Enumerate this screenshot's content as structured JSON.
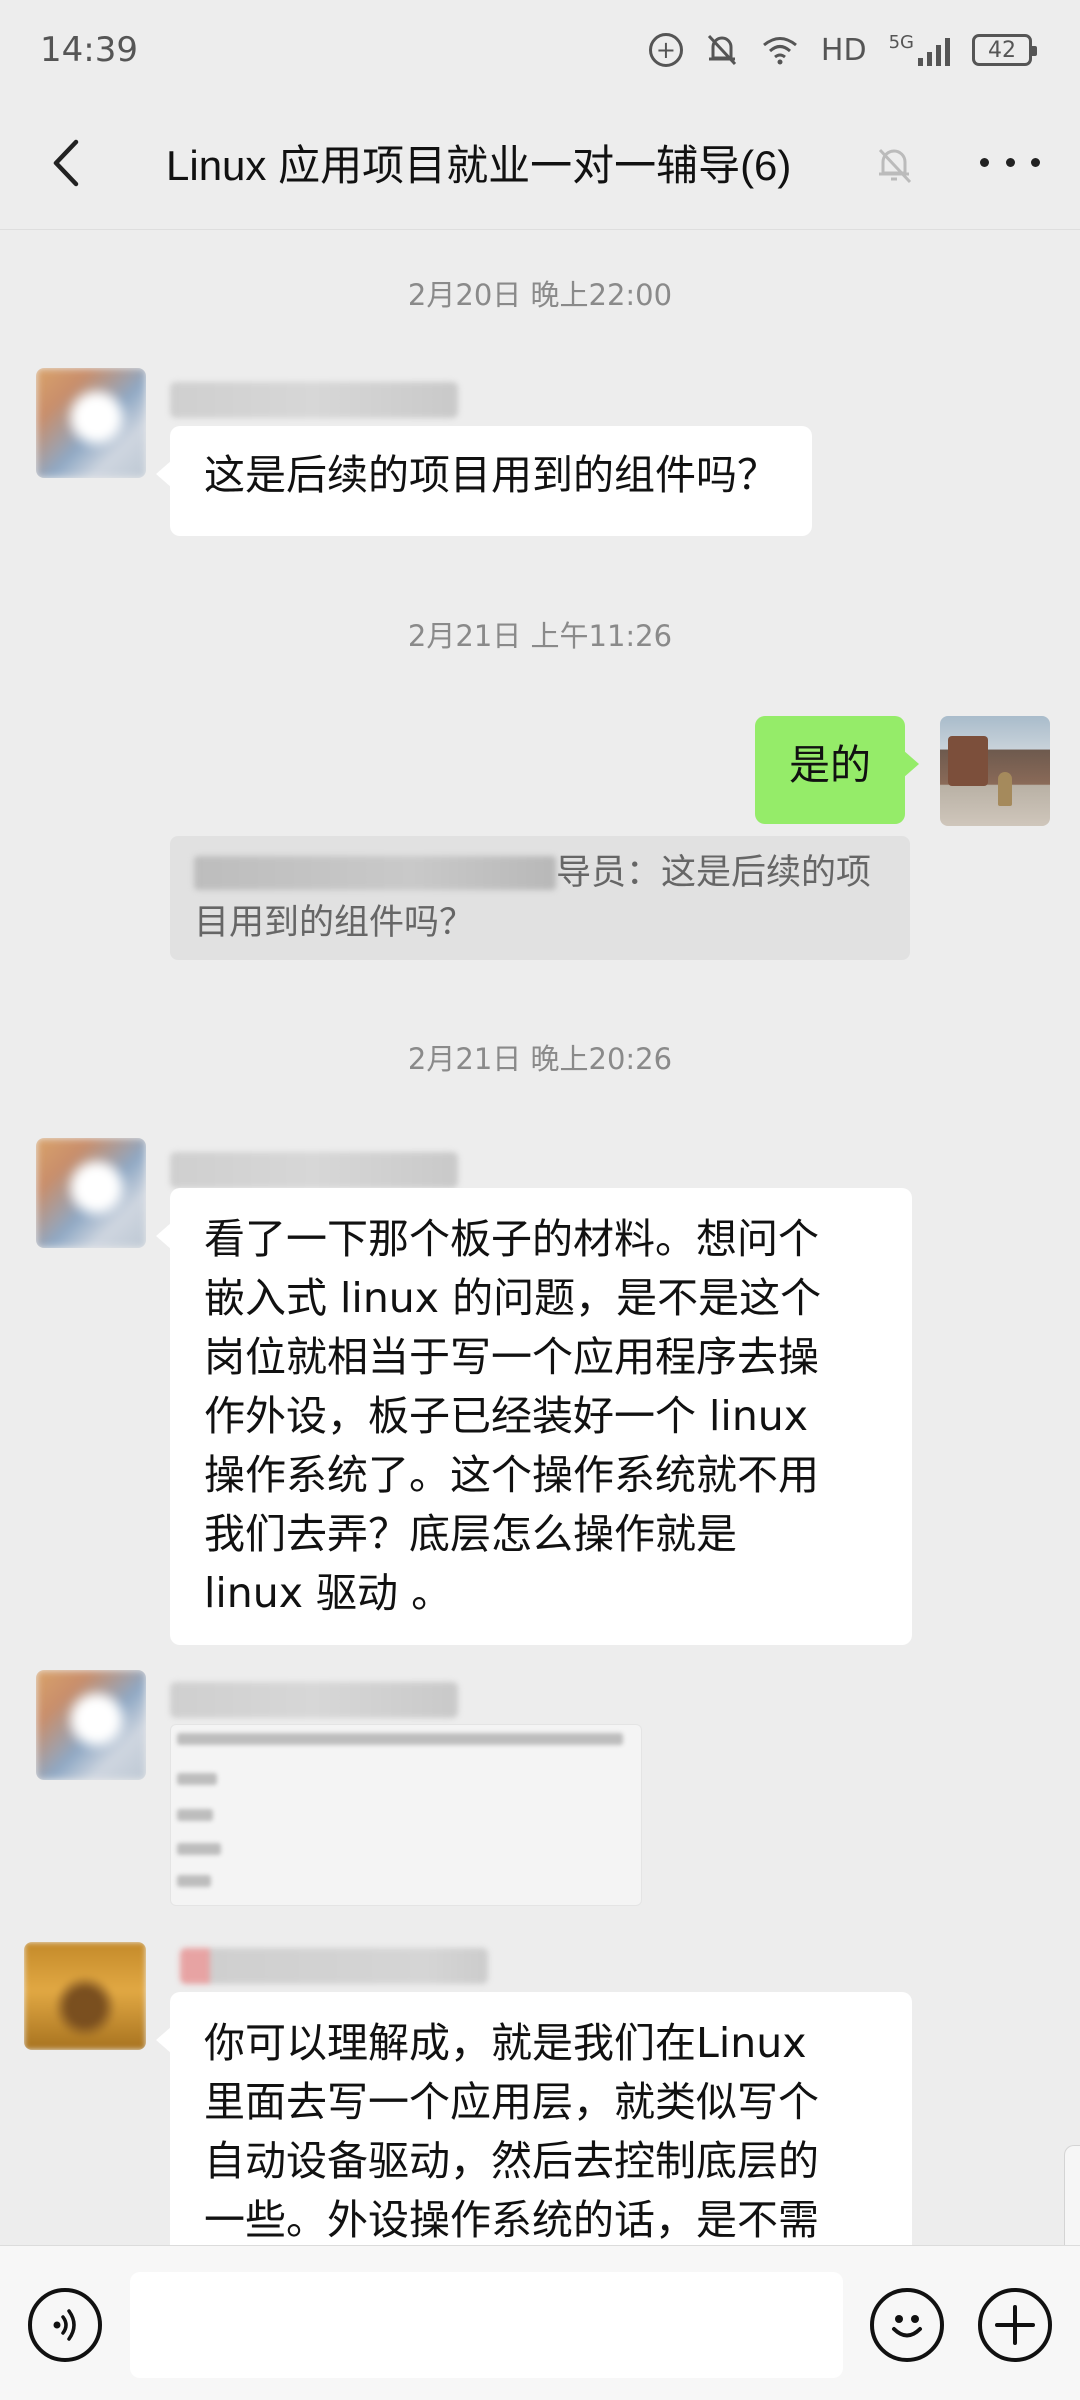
{
  "status_bar": {
    "time": "14:39",
    "network": "HD",
    "network_gen": "5G",
    "battery": "42"
  },
  "header": {
    "title": "Linux 应用项目就业一对一辅导(6)"
  },
  "messages": {
    "t1": "2月20日 晚上22:00",
    "m1": "这是后续的项目用到的组件吗？",
    "t2": "2月21日 上午11:26",
    "m2": "是的",
    "q2_suffix": "导员：这是后续的项目用到的组件吗？",
    "t3": "2月21日 晚上20:26",
    "m3_lines": [
      "看了一下那个板子的材料。想问个",
      "嵌入式 linux 的问题，是不是这个",
      "岗位就相当于写一个应用程序去操",
      "作外设，板子已经装好一个 linux",
      "操作系统了。这个操作系统就不用",
      "我们去弄？底层怎么操作就是",
      "linux 驱动 。"
    ],
    "m5_lines": [
      "你可以理解成，就是我们在Linux",
      "里面去写一个应用层，就类似写个",
      "自动设备驱动，然后去控制底层的",
      "一些。外设操作系统的话，是不需"
    ]
  },
  "input_bar": {
    "text": ""
  },
  "icons": {
    "back": "back-arrow-icon",
    "mute": "bell-off-icon",
    "more": "more-dots-icon",
    "voice": "voice-icon",
    "emoji": "emoji-icon",
    "plus": "plus-icon"
  }
}
